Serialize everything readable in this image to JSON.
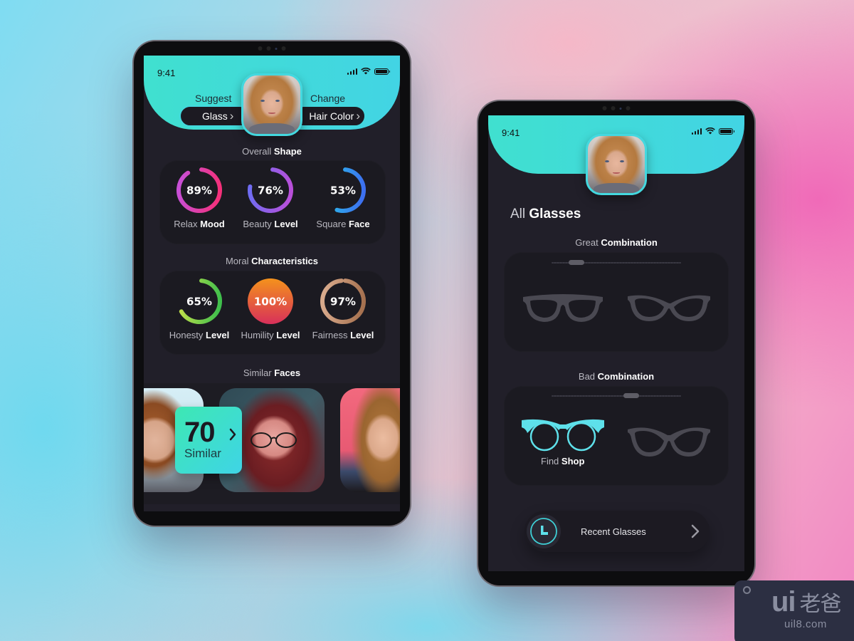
{
  "colors": {
    "accent_teal": "#43d8df",
    "hero_gradient_start": "#40e0cf",
    "hero_gradient_end": "#42d4e4",
    "screen_bg": "#211f29",
    "card_bg": "#1b1a21",
    "glasses_inactive": "#4a4952",
    "glasses_active": "#5ee0ea"
  },
  "left_phone": {
    "status": {
      "time": "9:41",
      "signal_icon": "cellular-signal-icon",
      "wifi_icon": "wifi-icon",
      "battery_icon": "battery-icon"
    },
    "header": {
      "suggest_label": "Suggest",
      "suggest_button": "Glass",
      "change_label": "Change",
      "change_button": "Hair Color",
      "chevron": "›"
    },
    "overall_shape": {
      "title_light": "Overall ",
      "title_bold": "Shape",
      "metrics": [
        {
          "value_text": "89%",
          "value": 89,
          "label_light": "Relax ",
          "label_bold": "Mood",
          "gradient": [
            "#c84fd6",
            "#f5307a"
          ]
        },
        {
          "value_text": "76%",
          "value": 76,
          "label_light": "Beauty ",
          "label_bold": "Level",
          "gradient": [
            "#6f6cf2",
            "#b94fd9"
          ]
        },
        {
          "value_text": "53%",
          "value": 53,
          "label_light": "Square ",
          "label_bold": "Face",
          "gradient": [
            "#27c9ea",
            "#3d6ff0"
          ]
        }
      ]
    },
    "moral_characteristics": {
      "title_light": "Moral ",
      "title_bold": "Characteristics",
      "metrics": [
        {
          "value_text": "65%",
          "value": 65,
          "label_light": "Honesty ",
          "label_bold": "Level",
          "gradient": [
            "#c5e04a",
            "#3fbf4c"
          ]
        },
        {
          "value_text": "100%",
          "value": 100,
          "label_light": "Humility ",
          "label_bold": "Level",
          "gradient": [
            "#f4921c",
            "#d8305a"
          ],
          "filled": true
        },
        {
          "value_text": "97%",
          "value": 97,
          "label_light": "Fairness ",
          "label_bold": "Level",
          "gradient": [
            "#d9ab8d",
            "#a6714f"
          ]
        }
      ]
    },
    "similar_faces": {
      "title_light": "Similar ",
      "title_bold": "Faces",
      "count": "70",
      "count_label": "Similar",
      "chevron": "›"
    }
  },
  "right_phone": {
    "status": {
      "time": "9:41"
    },
    "page_title_light": "All ",
    "page_title_bold": "Glasses",
    "great_combination": {
      "title_light": "Great ",
      "title_bold": "Combination",
      "slider_position": 0.15,
      "items": [
        {
          "name": "wayfarer-glasses",
          "active": false
        },
        {
          "name": "cat-eye-glasses",
          "active": false
        }
      ]
    },
    "bad_combination": {
      "title_light": "Bad ",
      "title_bold": "Combination",
      "slider_position": 0.63,
      "items": [
        {
          "name": "round-browline-glasses",
          "active": true,
          "caption_light": "Find ",
          "caption_bold": "Shop"
        },
        {
          "name": "cat-eye-wide-glasses",
          "active": false
        }
      ]
    },
    "recent_button": {
      "label": "Recent Glasses",
      "icon": "clock-icon",
      "chevron": "›"
    }
  },
  "watermark": {
    "brand": "ui",
    "brand_cjk": "老爸",
    "url": "uil8.com"
  }
}
